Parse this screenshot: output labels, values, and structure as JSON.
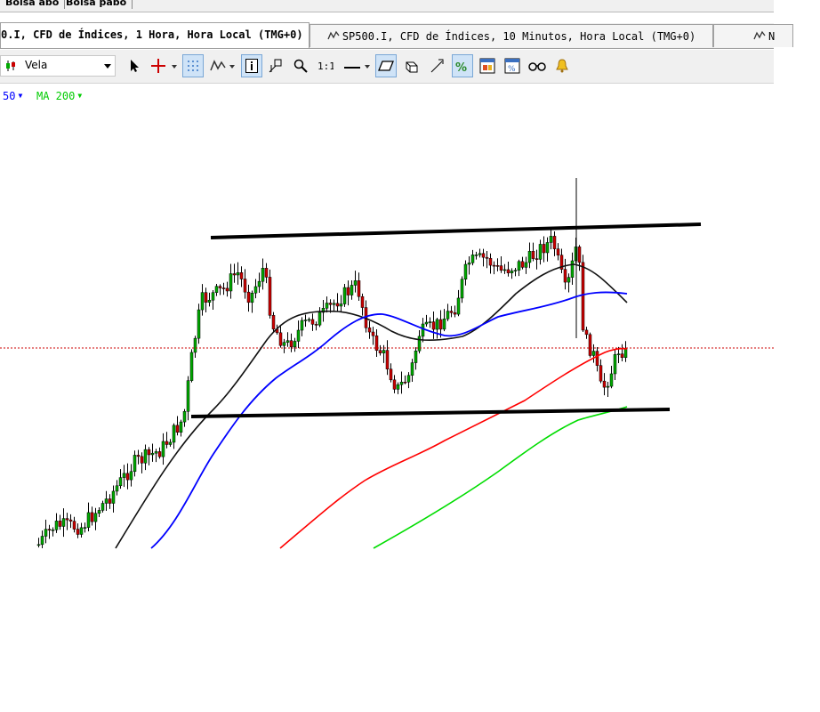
{
  "top_buttons": [
    "Bolsa abo",
    "Bolsa pabo"
  ],
  "tabs": [
    {
      "label": "0.I, CFD de Índices, 1 Hora, Hora Local (TMG+0)",
      "active": true
    },
    {
      "label": "SP500.I, CFD de Índices, 10 Minutos, Hora Local (TMG+0)",
      "active": false
    },
    {
      "label": "N",
      "active": false
    }
  ],
  "toolbar": {
    "chart_type": "Vela",
    "buttons": [
      "cursor-icon",
      "crosshair-icon",
      "grid-icon",
      "indicator-icon",
      "info-icon",
      "trendline-tool-icon",
      "zoom-icon",
      "scale-icon",
      "line-tool-icon",
      "eraser-icon",
      "cube-icon",
      "fibonacci-icon",
      "trade-icon",
      "window-icon",
      "window-alt-icon",
      "glasses-icon",
      "alert-bell-icon"
    ]
  },
  "indicators": [
    {
      "label": "50",
      "color": "#0000ff"
    },
    {
      "label": "MA 200",
      "color": "#00cc00"
    }
  ],
  "chart_colors": {
    "price_line": "#cc0000",
    "ma_black": "#000000",
    "ma_blue": "#0000ff",
    "ma_red": "#ff0000",
    "ma_green": "#00cc00",
    "bull": "#00aa00",
    "bear": "#cc0000"
  }
}
